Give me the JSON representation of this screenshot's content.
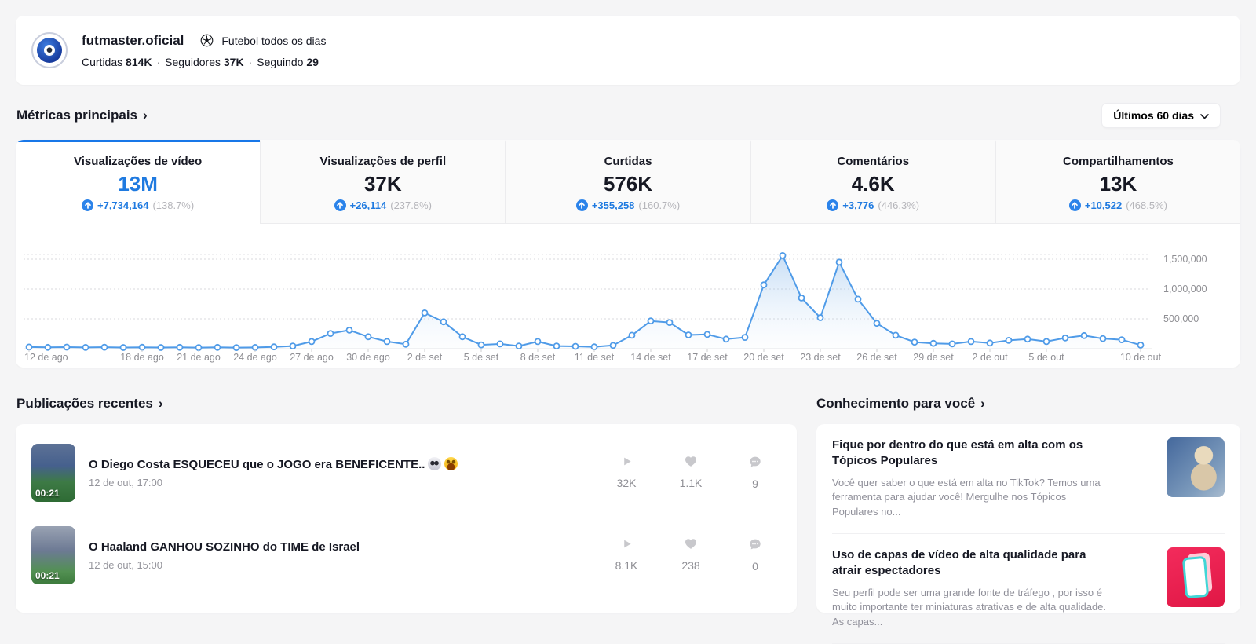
{
  "header": {
    "username": "futmaster.oficial",
    "separator": "|",
    "tagline": "Futebol todos os dias",
    "dot": "·",
    "stats": [
      {
        "label": "Curtidas",
        "value": "814K"
      },
      {
        "label": "Seguidores",
        "value": "37K"
      },
      {
        "label": "Seguindo",
        "value": "29"
      }
    ]
  },
  "metrics": {
    "title": "Métricas principais",
    "chevron": "›",
    "range_button": {
      "label": "Últimos 60 dias",
      "icon": "chevron-down"
    },
    "tabs": [
      {
        "label": "Visualizações de vídeo",
        "value": "13M",
        "delta": "+7,734,164",
        "percent": "(138.7%)",
        "active": true
      },
      {
        "label": "Visualizações de perfil",
        "value": "37K",
        "delta": "+26,114",
        "percent": "(237.8%)",
        "active": false
      },
      {
        "label": "Curtidas",
        "value": "576K",
        "delta": "+355,258",
        "percent": "(160.7%)",
        "active": false
      },
      {
        "label": "Comentários",
        "value": "4.6K",
        "delta": "+3,776",
        "percent": "(446.3%)",
        "active": false
      },
      {
        "label": "Compartilhamentos",
        "value": "13K",
        "delta": "+10,522",
        "percent": "(468.5%)",
        "active": false
      }
    ]
  },
  "chart_data": {
    "type": "line",
    "series_name": "Visualizações de vídeo",
    "line_color": "#4f9be8",
    "ylim": [
      0,
      1580000
    ],
    "grid": true,
    "legend": "none",
    "y_ticks": [
      {
        "value": 500000,
        "label": "500,000"
      },
      {
        "value": 1000000,
        "label": "1,000,000"
      },
      {
        "value": 1500000,
        "label": "1,500,000"
      }
    ],
    "x_ticks": [
      {
        "index": 0,
        "label": "12 de ago"
      },
      {
        "index": 6,
        "label": "18 de ago"
      },
      {
        "index": 9,
        "label": "21 de ago"
      },
      {
        "index": 12,
        "label": "24 de ago"
      },
      {
        "index": 15,
        "label": "27 de ago"
      },
      {
        "index": 18,
        "label": "30 de ago"
      },
      {
        "index": 21,
        "label": "2 de set"
      },
      {
        "index": 24,
        "label": "5 de set"
      },
      {
        "index": 27,
        "label": "8 de set"
      },
      {
        "index": 30,
        "label": "11 de set"
      },
      {
        "index": 33,
        "label": "14 de set"
      },
      {
        "index": 36,
        "label": "17 de set"
      },
      {
        "index": 39,
        "label": "20 de set"
      },
      {
        "index": 42,
        "label": "23 de set"
      },
      {
        "index": 45,
        "label": "26 de set"
      },
      {
        "index": 48,
        "label": "29 de set"
      },
      {
        "index": 51,
        "label": "2 de out"
      },
      {
        "index": 54,
        "label": "5 de out"
      },
      {
        "index": 59,
        "label": "10 de out"
      }
    ],
    "values": [
      28000,
      22000,
      26000,
      21000,
      25000,
      20000,
      24000,
      20000,
      23000,
      19000,
      22000,
      18000,
      21000,
      30000,
      45000,
      120000,
      255000,
      310000,
      200000,
      120000,
      75000,
      600000,
      450000,
      200000,
      65000,
      80000,
      45000,
      120000,
      45000,
      40000,
      30000,
      55000,
      225000,
      465000,
      440000,
      230000,
      240000,
      160000,
      190000,
      1070000,
      1560000,
      850000,
      520000,
      1450000,
      830000,
      425000,
      225000,
      110000,
      90000,
      80000,
      120000,
      95000,
      140000,
      160000,
      120000,
      180000,
      220000,
      170000,
      150000,
      60000
    ]
  },
  "posts": {
    "title": "Publicações recentes",
    "chevron": "›",
    "items": [
      {
        "title": "O Diego Costa ESQUECEU que o JOGO era BENEFICENTE..",
        "emojis": "💀 🤣",
        "date": "12 de out, 17:00",
        "duration": "00:21",
        "views": "32K",
        "likes": "1.1K",
        "comments": "9"
      },
      {
        "title": "O Haaland GANHOU SOZINHO do TIME de Israel",
        "emojis": "",
        "date": "12 de out, 15:00",
        "duration": "00:21",
        "views": "8.1K",
        "likes": "238",
        "comments": "0"
      }
    ]
  },
  "knowledge": {
    "title": "Conhecimento para você",
    "chevron": "›",
    "items": [
      {
        "title": "Fique por dentro do que está em alta com os Tópicos Populares",
        "body": "Você quer saber o que está em alta no TikTok? Temos uma ferramenta para ajudar você! Mergulhe nos Tópicos Populares no..."
      },
      {
        "title": "Uso de capas de vídeo de alta qualidade para atrair espectadores",
        "body": "Seu perfil pode ser uma grande fonte de tráfego , por isso é muito importante ter miniaturas atrativas e de alta qualidade. As capas..."
      }
    ]
  },
  "colors": {
    "accent": "#1877e8",
    "chart_line": "#4f9be8",
    "muted_text": "#90909a",
    "page_bg": "#f5f5f6"
  }
}
